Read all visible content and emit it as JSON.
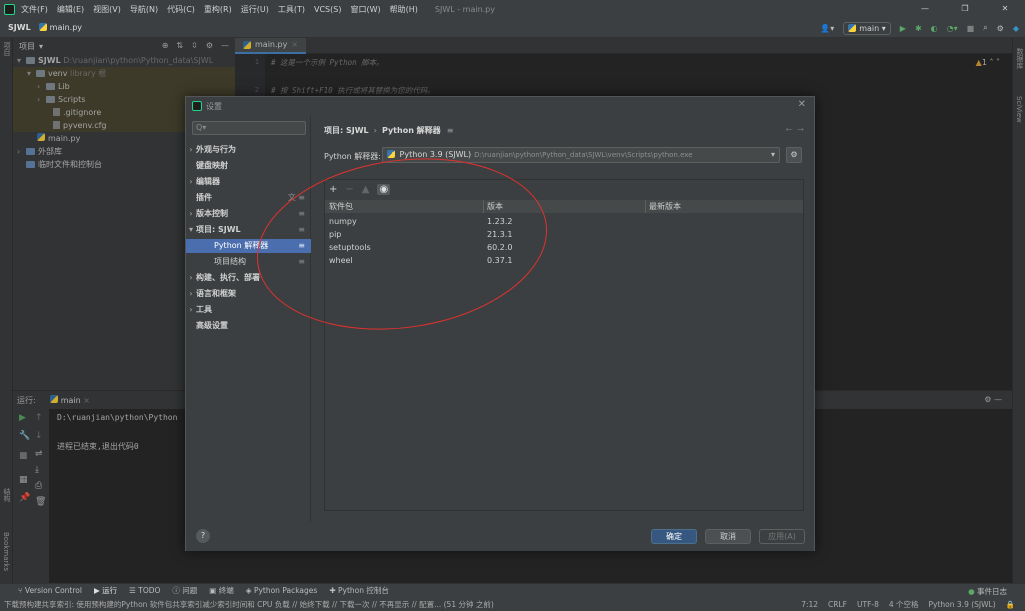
{
  "menubar": {
    "items": [
      "文件(F)",
      "编辑(E)",
      "视图(V)",
      "导航(N)",
      "代码(C)",
      "重构(R)",
      "运行(U)",
      "工具(T)",
      "VCS(S)",
      "窗口(W)",
      "帮助(H)"
    ],
    "window_title": "SJWL - main.py",
    "win_min": "—",
    "win_max": "❐",
    "win_close": "✕"
  },
  "navbar": {
    "project": "SJWL",
    "file": "main.py",
    "run_config": "main"
  },
  "project_panel": {
    "title": "项目",
    "tree": [
      {
        "label": "SJWL",
        "hint": "D:\\ruanjian\\python\\Python_data\\SJWL"
      },
      {
        "label": "venv",
        "hint": "library 根"
      },
      {
        "label": "Lib"
      },
      {
        "label": "Scripts"
      },
      {
        "label": ".gitignore"
      },
      {
        "label": "pyvenv.cfg"
      },
      {
        "label": "main.py"
      },
      {
        "label": "外部库"
      },
      {
        "label": "临时文件和控制台"
      }
    ]
  },
  "editor": {
    "tab": "main.py",
    "line1": "# 这是一个示例 Python 脚本。",
    "line2": "# 按 Shift+F10 执行或将其替换为您的代码。",
    "warning_count": "1",
    "gutter": [
      "1",
      "2"
    ]
  },
  "run_panel": {
    "label": "运行:",
    "tab": "main",
    "output_line1": "D:\\ruanjian\\python\\Python",
    "output_line2": "进程已结束,退出代码0"
  },
  "dialog": {
    "title": "设置",
    "search_placeholder": "Q▾",
    "nav": [
      {
        "label": "外观与行为"
      },
      {
        "label": "键盘映射"
      },
      {
        "label": "编辑器"
      },
      {
        "label": "插件"
      },
      {
        "label": "版本控制"
      },
      {
        "label": "项目: SJWL"
      },
      {
        "label": "Python 解释器"
      },
      {
        "label": "项目结构"
      },
      {
        "label": "构建、执行、部署"
      },
      {
        "label": "语言和框架"
      },
      {
        "label": "工具"
      },
      {
        "label": "高级设置"
      }
    ],
    "breadcrumb": {
      "parent": "项目: SJWL",
      "current": "Python 解释器"
    },
    "interpreter_label": "Python 解释器:",
    "interpreter_name": "Python 3.9 (SJWL)",
    "interpreter_path": "D:\\ruanjian\\python\\Python_data\\SJWL\\venv\\Scripts\\python.exe",
    "table": {
      "headers": [
        "软件包",
        "版本",
        "最新版本"
      ],
      "rows": [
        {
          "name": "numpy",
          "version": "1.23.2",
          "latest": ""
        },
        {
          "name": "pip",
          "version": "21.3.1",
          "latest": ""
        },
        {
          "name": "setuptools",
          "version": "60.2.0",
          "latest": ""
        },
        {
          "name": "wheel",
          "version": "0.37.1",
          "latest": ""
        }
      ]
    },
    "buttons": {
      "help": "?",
      "ok": "确定",
      "cancel": "取消",
      "apply": "应用(A)"
    }
  },
  "toolwindows": {
    "items": [
      "Version Control",
      "运行",
      "TODO",
      "问题",
      "终端",
      "Python Packages",
      "Python 控制台"
    ],
    "event_log": "事件日志"
  },
  "statusbar": {
    "message": "下载预构建共享索引: 使用预构建的Python 软件包共享索引减少索引时间和 CPU 负载 // 始终下载 // 下载一次 // 不再显示 // 配置... (51 分钟 之前)",
    "position": "7:12",
    "line_sep": "CRLF",
    "encoding": "UTF-8",
    "indent": "4 个空格",
    "interpreter": "Python 3.9 (SJWL)"
  },
  "stripes": {
    "left_top": "项目",
    "left_bottom": "结构",
    "bookmarks": "Bookmarks",
    "right": "数据库",
    "sciview": "SciView"
  },
  "colors": {
    "accent": "#4b6eaf",
    "annotation": "#e0322e",
    "ok_button": "#365880"
  }
}
